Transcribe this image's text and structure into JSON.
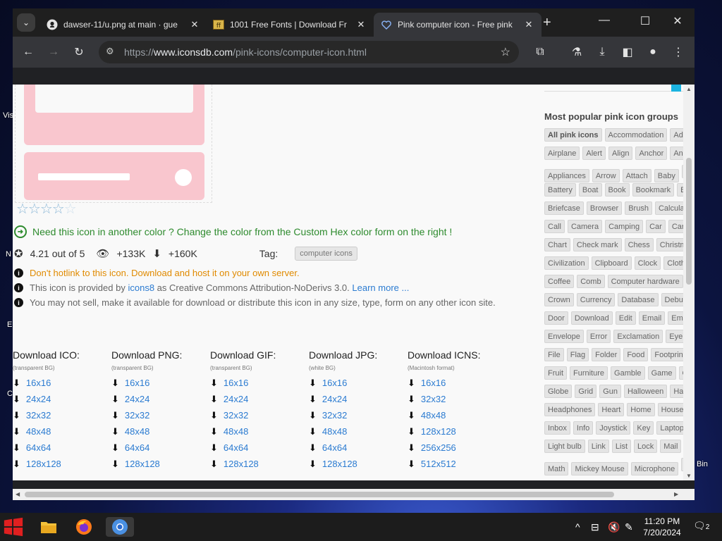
{
  "browser": {
    "tabs": [
      {
        "title": "dawser-11/u.png at main · gue",
        "favicon": "github-icon",
        "active": false
      },
      {
        "title": "1001 Free Fonts | Download Fr",
        "favicon": "fonts-icon",
        "active": false
      },
      {
        "title": "Pink computer icon - Free pink",
        "favicon": "heart-icon",
        "active": true
      }
    ],
    "url_prefix": "https://",
    "url_domain": "www.iconsdb.com",
    "url_path": "/pink-icons/computer-icon.html"
  },
  "icon": {
    "color": "#f9c6ce",
    "rating_stars": 4.21
  },
  "notice": "Need this icon in another color ? Change the color from the Custom Hex color form on the right !",
  "stats": {
    "rating": "4.21 out of 5",
    "views": "+133K",
    "downloads": "+160K",
    "tag_label": "Tag:",
    "tag": "computer icons"
  },
  "info": {
    "hotlink": "Don't hotlink to this icon. Download and host it on your own server.",
    "provided_prefix": "This icon is provided by",
    "provider": "icons8",
    "license": "as Creative Commons Attribution-NoDerivs 3.0.",
    "learn_more": "Learn more ...",
    "restriction": "You may not sell, make it available for download or distribute this icon in any size, type, form on any other icon site."
  },
  "downloads": [
    {
      "title": "Download ICO:",
      "sub": "(transparent BG)",
      "sizes": [
        "16x16",
        "24x24",
        "32x32",
        "48x48",
        "64x64",
        "128x128"
      ]
    },
    {
      "title": "Download PNG:",
      "sub": "(transparent BG)",
      "sizes": [
        "16x16",
        "24x24",
        "32x32",
        "48x48",
        "64x64",
        "128x128"
      ]
    },
    {
      "title": "Download GIF:",
      "sub": "(transparent BG)",
      "sizes": [
        "16x16",
        "24x24",
        "32x32",
        "48x48",
        "64x64",
        "128x128"
      ]
    },
    {
      "title": "Download JPG:",
      "sub": "(white BG)",
      "sizes": [
        "16x16",
        "24x24",
        "32x32",
        "48x48",
        "64x64",
        "128x128"
      ]
    },
    {
      "title": "Download ICNS:",
      "sub": "(Macintosh format)",
      "sizes": [
        "16x16",
        "32x32",
        "48x48",
        "128x128",
        "256x256",
        "512x512"
      ]
    }
  ],
  "sidebar": {
    "heading": "Most popular pink icon groups",
    "rows": [
      [
        "All pink icons",
        "Accommodation",
        "Ad"
      ],
      [
        "Airplane",
        "Alert",
        "Align",
        "Anchor",
        "Ani"
      ],
      [
        "Appliances",
        "Arrow",
        "Attach",
        "Baby",
        ""
      ],
      [
        "Battery",
        "Boat",
        "Book",
        "Bookmark",
        "B"
      ],
      [
        "Briefcase",
        "Browser",
        "Brush",
        "Calculat"
      ],
      [
        "Call",
        "Camera",
        "Camping",
        "Car",
        "Car I"
      ],
      [
        "Chart",
        "Check mark",
        "Chess",
        "Christm"
      ],
      [
        "Civilization",
        "Clipboard",
        "Clock",
        "Cloth"
      ],
      [
        "Coffee",
        "Comb",
        "Computer hardware"
      ],
      [
        "Crown",
        "Currency",
        "Database",
        "Debug"
      ],
      [
        "Door",
        "Download",
        "Edit",
        "Email",
        "Emo"
      ],
      [
        "Envelope",
        "Error",
        "Exclamation",
        "Eye"
      ],
      [
        "File",
        "Flag",
        "Folder",
        "Food",
        "Footprint"
      ],
      [
        "Fruit",
        "Furniture",
        "Gamble",
        "Game",
        "G"
      ],
      [
        "Globe",
        "Grid",
        "Gun",
        "Halloween",
        "Han"
      ],
      [
        "Headphones",
        "Heart",
        "Home",
        "House"
      ],
      [
        "Inbox",
        "Info",
        "Joystick",
        "Key",
        "Laptop"
      ],
      [
        "Light bulb",
        "Link",
        "List",
        "Lock",
        "Mail"
      ],
      [
        "Math",
        "Mickey Mouse",
        "Microphone",
        ""
      ]
    ]
  },
  "desktop": {
    "labels": [
      "Vis",
      "N",
      "E",
      "C",
      "Bin"
    ]
  },
  "taskbar": {
    "time": "11:20 PM",
    "date": "7/20/2024",
    "notifications": "2"
  }
}
